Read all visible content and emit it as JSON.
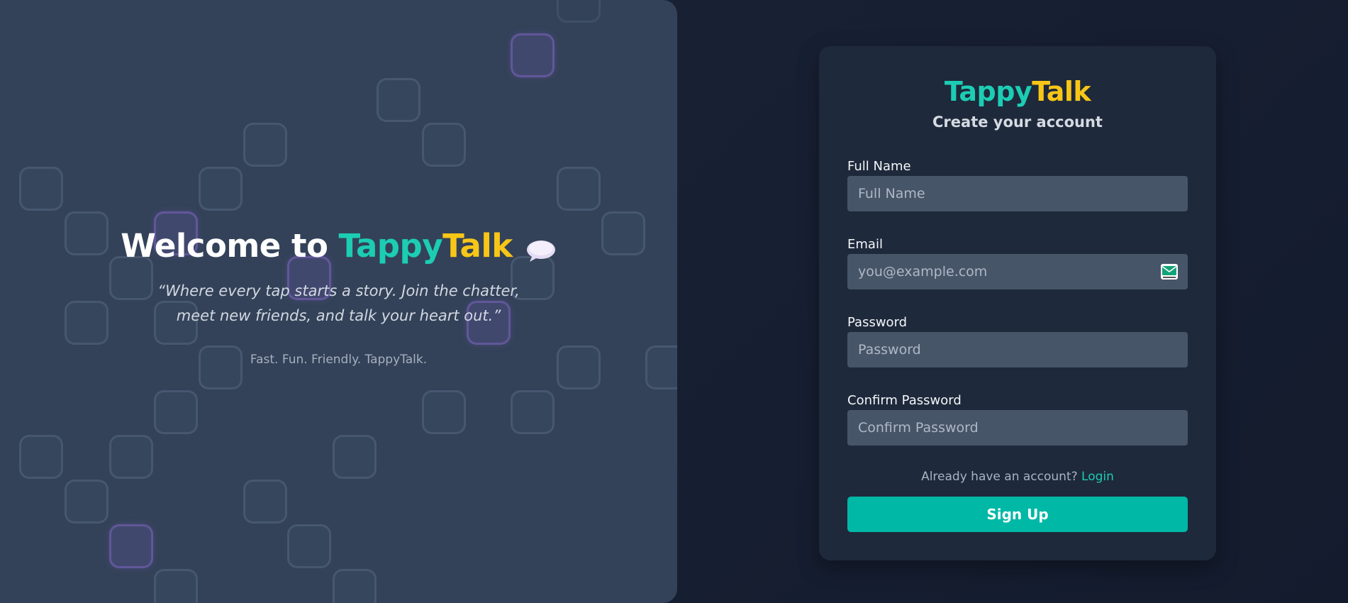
{
  "hero": {
    "title_prefix": "Welcome to ",
    "brand_part1": "Tappy",
    "brand_part2": "Talk",
    "title_icon": "speech-bubble-icon",
    "quote": "“Where every tap starts a story. Join the chatter, meet new friends, and talk your heart out.”",
    "tagline": "Fast. Fun. Friendly. TappyTalk."
  },
  "card": {
    "brand_part1": "Tappy",
    "brand_part2": "Talk",
    "subtitle": "Create your account",
    "fields": {
      "full_name": {
        "label": "Full Name",
        "placeholder": "Full Name",
        "value": ""
      },
      "email": {
        "label": "Email",
        "placeholder": "you@example.com",
        "value": "",
        "icon": "mail-icon"
      },
      "password": {
        "label": "Password",
        "placeholder": "Password",
        "value": ""
      },
      "confirm_password": {
        "label": "Confirm Password",
        "placeholder": "Confirm Password",
        "value": ""
      }
    },
    "login_prompt": "Already have an account? ",
    "login_link": "Login",
    "signup_label": "Sign Up"
  },
  "colors": {
    "brand_primary": "#1ccdb4",
    "brand_secondary": "#f8c617",
    "button": "#00b8a6",
    "card_bg": "#1e293b",
    "hero_bg": "#334258",
    "input_bg": "#475569"
  }
}
